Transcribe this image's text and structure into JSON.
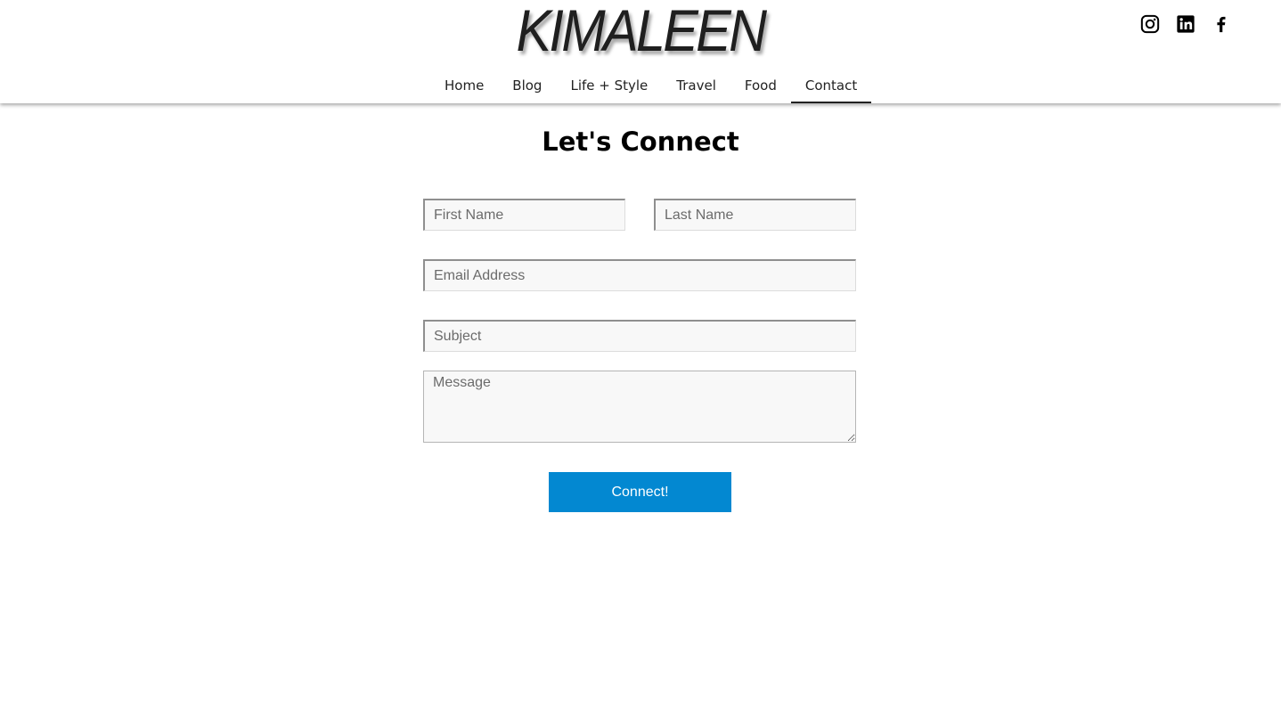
{
  "brand": {
    "logo_text": "KIMALEEN"
  },
  "social": [
    {
      "icon": "instagram-icon"
    },
    {
      "icon": "linkedin-icon"
    },
    {
      "icon": "facebook-icon"
    }
  ],
  "nav": {
    "items": [
      {
        "label": "Home"
      },
      {
        "label": "Blog"
      },
      {
        "label": "Life + Style"
      },
      {
        "label": "Travel"
      },
      {
        "label": "Food"
      },
      {
        "label": "Contact",
        "active": true
      }
    ]
  },
  "contact": {
    "title": "Let's Connect",
    "first_name": {
      "placeholder": "First Name",
      "value": ""
    },
    "last_name": {
      "placeholder": "Last Name",
      "value": ""
    },
    "email": {
      "placeholder": "Email Address",
      "value": ""
    },
    "subject": {
      "placeholder": "Subject",
      "value": ""
    },
    "message": {
      "placeholder": "Message",
      "value": ""
    },
    "submit_label": "Connect!"
  },
  "colors": {
    "accent": "#0388d1",
    "text": "#000000",
    "field_bg": "#f8f8f8"
  }
}
